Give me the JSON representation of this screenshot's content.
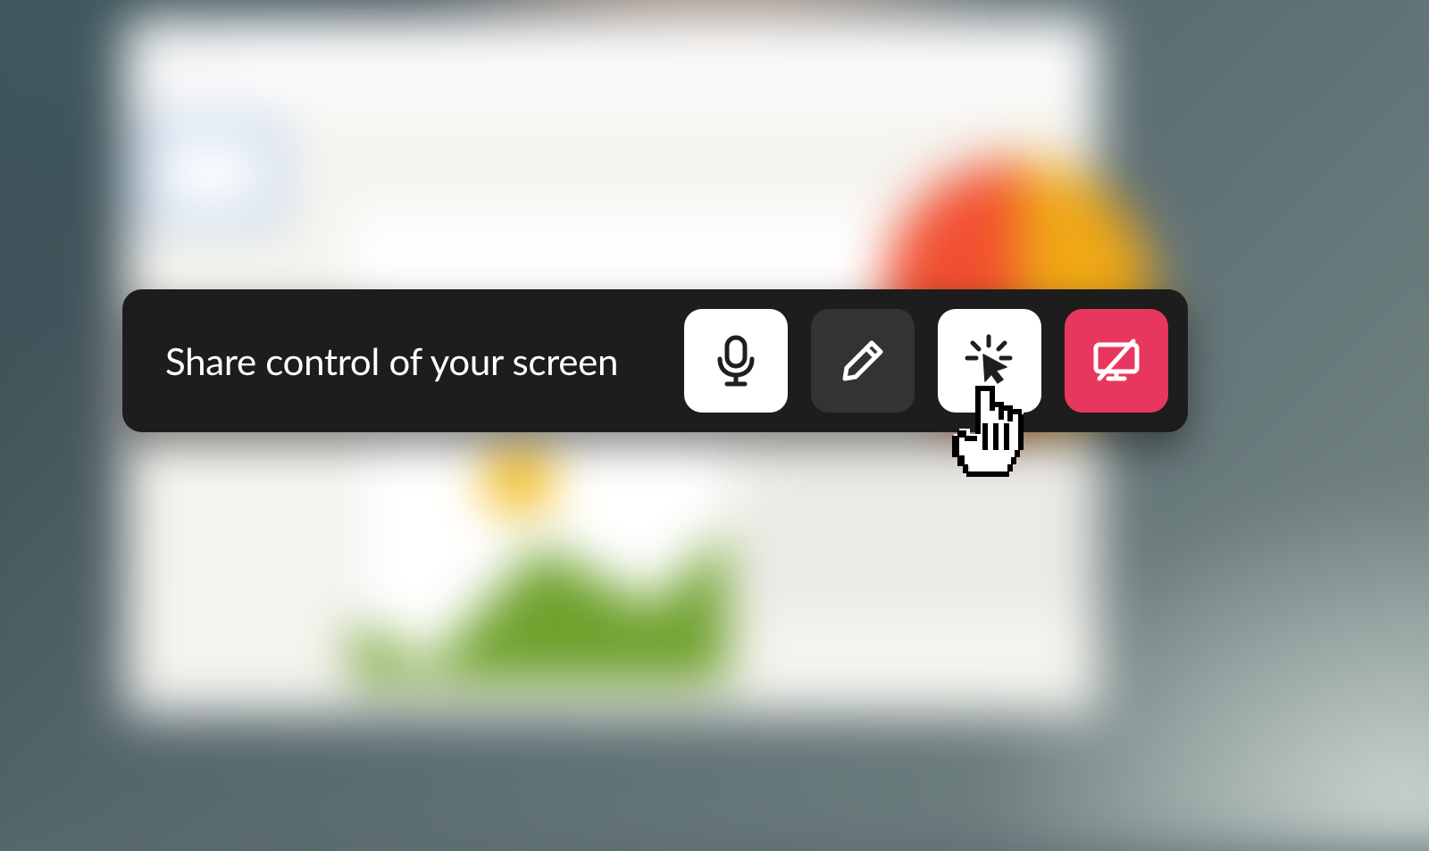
{
  "toolbar": {
    "label": "Share control of your screen",
    "buttons": {
      "mic": {
        "name": "microphone-button",
        "icon": "microphone-icon"
      },
      "draw": {
        "name": "draw-button",
        "icon": "pencil-icon"
      },
      "share_control": {
        "name": "share-control-button",
        "icon": "cursor-click-icon"
      },
      "stop_share": {
        "name": "stop-screen-share-button",
        "icon": "screen-off-icon"
      }
    }
  },
  "colors": {
    "toolbar_bg": "#1d1d1d",
    "button_white": "#ffffff",
    "button_dark": "#333334",
    "button_red": "#e8375e"
  }
}
